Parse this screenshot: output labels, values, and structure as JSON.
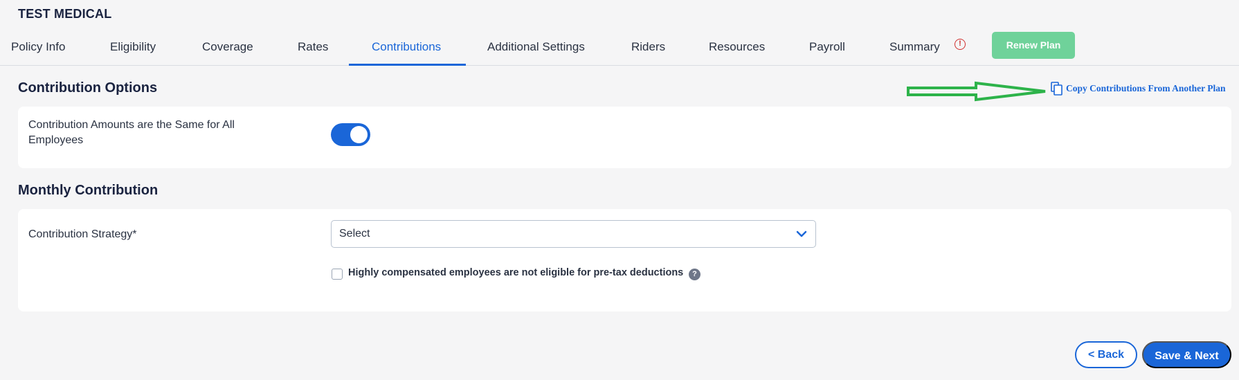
{
  "plan_title": "TEST MEDICAL",
  "tabs": [
    {
      "label": "Policy Info"
    },
    {
      "label": "Eligibility"
    },
    {
      "label": "Coverage"
    },
    {
      "label": "Rates"
    },
    {
      "label": "Contributions"
    },
    {
      "label": "Additional Settings"
    },
    {
      "label": "Riders"
    },
    {
      "label": "Resources"
    },
    {
      "label": "Payroll"
    },
    {
      "label": "Summary"
    }
  ],
  "active_tab": "Contributions",
  "summary_alert_glyph": "!",
  "renew_button": "Renew Plan",
  "copy_link": "Copy Contributions From Another Plan",
  "contribution_options": {
    "title": "Contribution Options",
    "same_for_all_line1": "Contribution Amounts are the Same for All",
    "same_for_all_line2": "Employees",
    "toggle_on": true
  },
  "monthly_contribution": {
    "title": "Monthly Contribution",
    "strategy_label": "Contribution Strategy*",
    "strategy_value": "Select",
    "hce_checkbox_label": "Highly compensated employees are not eligible for pre-tax deductions",
    "hce_checked": false,
    "help_glyph": "?"
  },
  "footer": {
    "back_label": "< Back",
    "next_label": "Save & Next"
  },
  "colors": {
    "primary": "#1a66d8",
    "renew": "#6fd29a",
    "alert": "#d0302f",
    "annotation_arrow": "#2db34a"
  }
}
